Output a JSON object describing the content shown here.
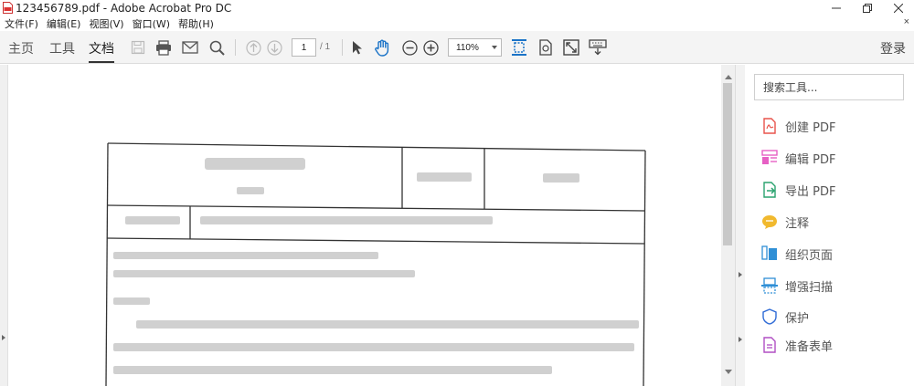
{
  "window": {
    "title": "123456789.pdf - Adobe Acrobat Pro DC",
    "minimize_label": "─",
    "restore_label": "❐",
    "close_label": "✕"
  },
  "menu": {
    "items": [
      "文件(F)",
      "编辑(E)",
      "视图(V)",
      "窗口(W)",
      "帮助(H)"
    ],
    "close_doc": "×"
  },
  "toolbar": {
    "tabs": [
      "主页",
      "工具",
      "文档"
    ],
    "active_tab": "文档",
    "page_current": "1",
    "page_total": "/ 1",
    "zoom": "110%",
    "login": "登录"
  },
  "icons": {
    "toolbar": [
      "save-icon",
      "print-icon",
      "email-icon",
      "search-icon",
      "prev-page-icon",
      "next-page-icon",
      "select-cursor-icon",
      "hand-tool-icon",
      "zoom-out-icon",
      "zoom-in-icon",
      "scrolling-mode-icon",
      "rotate-icon",
      "fullscreen-icon",
      "keyboard-icon"
    ]
  },
  "right_pane": {
    "search_placeholder": "搜索工具...",
    "tools": [
      {
        "label": "创建 PDF",
        "icon": "create-pdf-icon",
        "color": "#e8534b"
      },
      {
        "label": "编辑 PDF",
        "icon": "edit-pdf-icon",
        "color": "#e660c4"
      },
      {
        "label": "导出 PDF",
        "icon": "export-pdf-icon",
        "color": "#2aa36f"
      },
      {
        "label": "注释",
        "icon": "comment-icon",
        "color": "#f1b92e"
      },
      {
        "label": "组织页面",
        "icon": "organize-pages-icon",
        "color": "#2f8fd6"
      },
      {
        "label": "增强扫描",
        "icon": "enhance-scans-icon",
        "color": "#2f8fd6"
      },
      {
        "label": "保护",
        "icon": "protect-icon",
        "color": "#2f6bd6"
      },
      {
        "label": "准备表单",
        "icon": "prepare-form-icon",
        "color": "#b04fc4"
      }
    ]
  },
  "colors": {
    "toolbar_bg": "#f4f4f4",
    "accent_blue": "#2f8fd6"
  }
}
